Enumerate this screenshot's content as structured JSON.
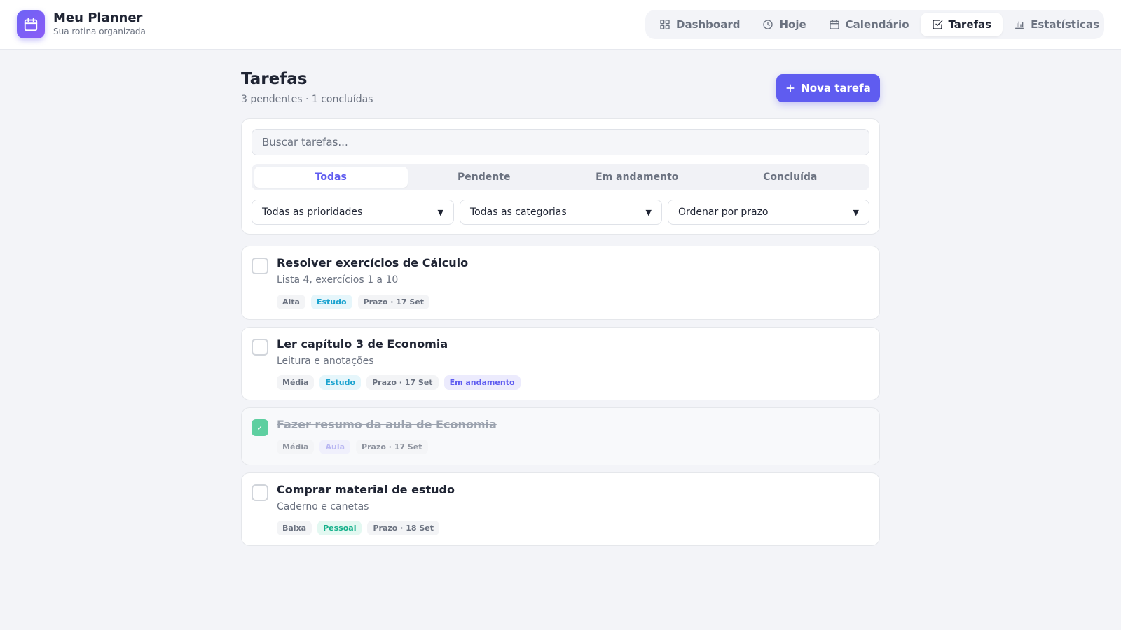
{
  "brand": {
    "title": "Meu Planner",
    "subtitle": "Sua rotina organizada",
    "icon": "calendar-icon",
    "color": "#6d63f5"
  },
  "nav": [
    {
      "label": "Dashboard",
      "icon": "grid-icon",
      "active": false
    },
    {
      "label": "Hoje",
      "icon": "clock-icon",
      "active": false
    },
    {
      "label": "Calendário",
      "icon": "calendar-icon",
      "active": false
    },
    {
      "label": "Tarefas",
      "icon": "check-square-icon",
      "active": true
    },
    {
      "label": "Estatísticas",
      "icon": "bar-chart-icon",
      "active": false
    }
  ],
  "page": {
    "title": "Tarefas",
    "summary": "3 pendentes · 1 concluídas",
    "new_button": "Nova tarefa",
    "new_button_icon": "plus-icon",
    "accent": "#5f5cf0"
  },
  "filters": {
    "search_placeholder": "Buscar tarefas...",
    "segments": [
      "Todas",
      "Pendente",
      "Em andamento",
      "Concluída"
    ],
    "active_segment": "Todas",
    "priority": "Todas as prioridades",
    "category": "Todas as categorias",
    "sort": "Ordenar por prazo"
  },
  "tasks": [
    {
      "title": "Resolver exercícios de Cálculo",
      "description": "Lista 4, exercícios 1 a 10",
      "priority": "Alta",
      "category": "Estudo",
      "due": "Prazo · 17 Set",
      "status": "",
      "done": false
    },
    {
      "title": "Ler capítulo 3 de Economia",
      "description": "Leitura e anotações",
      "priority": "Média",
      "category": "Estudo",
      "due": "Prazo · 17 Set",
      "status": "Em andamento",
      "done": false
    },
    {
      "title": "Fazer resumo da aula de Economia",
      "description": "",
      "priority": "Média",
      "category": "Aula",
      "due": "Prazo · 17 Set",
      "status": "",
      "done": true,
      "check_mark": "✓"
    },
    {
      "title": "Comprar material de estudo",
      "description": "Caderno e canetas",
      "priority": "Baixa",
      "category": "Pessoal",
      "due": "Prazo · 18 Set",
      "status": "",
      "done": false
    }
  ]
}
